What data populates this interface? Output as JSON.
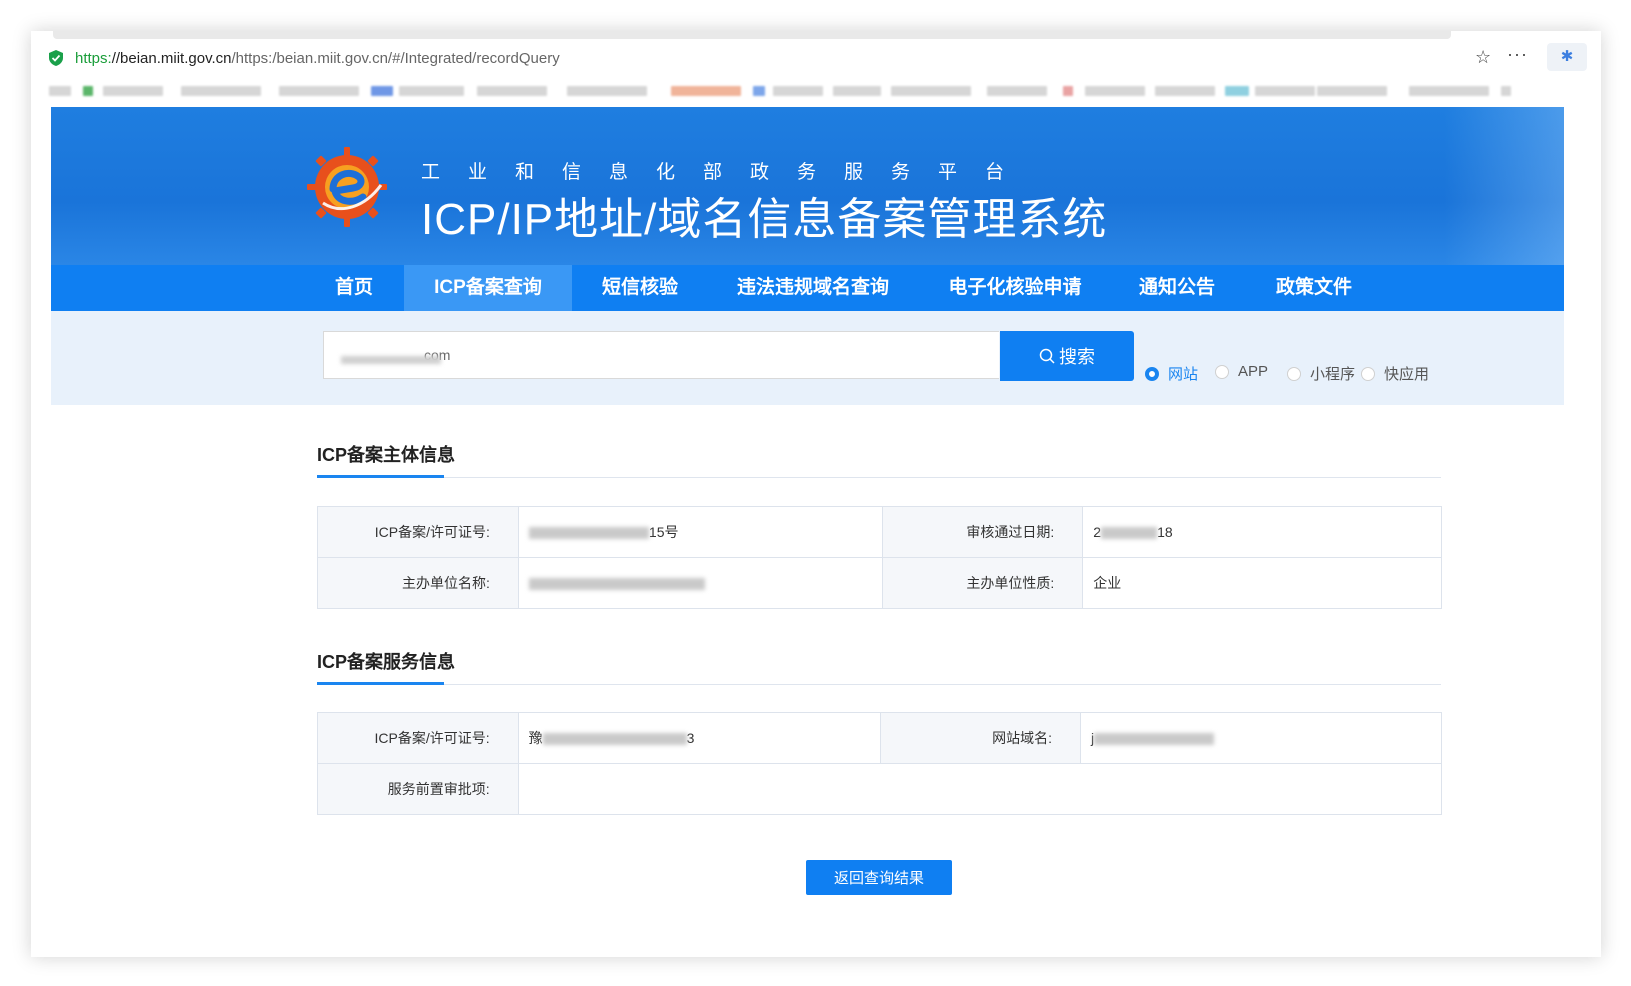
{
  "browser": {
    "url_scheme": "https:",
    "url_host": "//beian.miit.gov.cn",
    "url_path": "/https:/beian.miit.gov.cn/#/Integrated/recordQuery",
    "star_icon": "star-icon",
    "more_label": "···",
    "ext_label": "✱"
  },
  "banner": {
    "subtitle": "工业和信息化部政务服务平台",
    "title": "ICP/IP地址/域名信息备案管理系统"
  },
  "nav": {
    "items": [
      {
        "label": "首页"
      },
      {
        "label": "ICP备案查询"
      },
      {
        "label": "短信核验"
      },
      {
        "label": "违法违规域名查询"
      },
      {
        "label": "电子化核验申请"
      },
      {
        "label": "通知公告"
      },
      {
        "label": "政策文件"
      }
    ],
    "active_index": 1
  },
  "search": {
    "value": "com",
    "button_label": "搜索",
    "types": [
      {
        "label": "网站",
        "checked": true
      },
      {
        "label": "APP",
        "checked": false
      },
      {
        "label": "小程序",
        "checked": false
      },
      {
        "label": "快应用",
        "checked": false
      }
    ]
  },
  "subject_info": {
    "title": "ICP备案主体信息",
    "license_label": "ICP备案/许可证号:",
    "license_value_suffix": "15号",
    "approval_date_label": "审核通过日期:",
    "approval_date_prefix": "2",
    "approval_date_suffix": "18",
    "org_name_label": "主办单位名称:",
    "org_type_label": "主办单位性质:",
    "org_type_value": "企业"
  },
  "service_info": {
    "title": "ICP备案服务信息",
    "license_label": "ICP备案/许可证号:",
    "license_value_prefix": "豫",
    "license_value_suffix": "3",
    "domain_label": "网站域名:",
    "domain_prefix": "j",
    "preapproval_label": "服务前置审批项:",
    "preapproval_value": ""
  },
  "actions": {
    "back_label": "返回查询结果"
  },
  "colors": {
    "primary": "#0f7ff2",
    "banner": "#1f7ee0",
    "search_band": "#e8f1fb"
  }
}
